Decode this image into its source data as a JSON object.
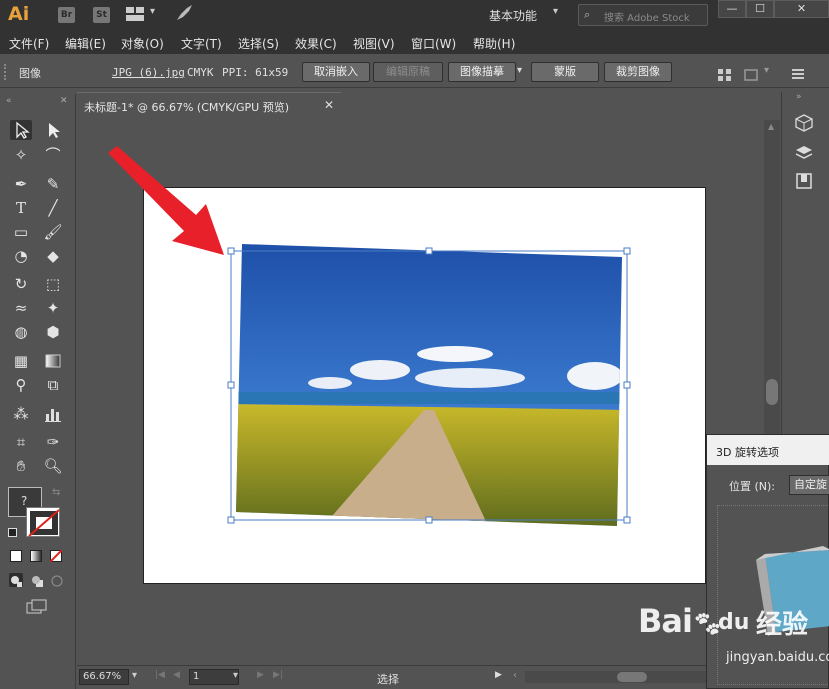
{
  "app": {
    "logo": "Ai",
    "badges": [
      "Br",
      "St"
    ],
    "workspace": "基本功能",
    "stock_search_placeholder": "搜索 Adobe Stock",
    "window_buttons": [
      "—",
      "☐",
      "✕"
    ]
  },
  "menu": [
    "文件(F)",
    "编辑(E)",
    "对象(O)",
    "文字(T)",
    "选择(S)",
    "效果(C)",
    "视图(V)",
    "窗口(W)",
    "帮助(H)"
  ],
  "control_bar": {
    "object_type": "图像",
    "file_name": "JPG (6).jpg",
    "color_mode": "CMYK",
    "ppi": "PPI: 61x59",
    "unembed": "取消嵌入",
    "edit_original": "编辑原稿",
    "image_trace": "图像描摹",
    "mask": "蒙版",
    "crop": "裁剪图像"
  },
  "document": {
    "tab_title": "未标题-1* @ 66.67% (CMYK/GPU 预览)",
    "close": "✕"
  },
  "statusbar": {
    "zoom": "66.67%",
    "artboard_number": "1",
    "tool_name": "选择"
  },
  "panel_3d": {
    "title": "3D 旋转选项",
    "position_label": "位置 (N):",
    "position_value": "自定旋"
  },
  "toolbar": {
    "fill_stroke_label": "?"
  },
  "watermark": {
    "brand": "Bai",
    "mid": "du",
    "cn": "经验",
    "url": "jingyan.baidu.com"
  },
  "colors": {
    "accent": "#e8a23b",
    "arrow": "#e8202a",
    "selection": "#4a7cc7"
  }
}
